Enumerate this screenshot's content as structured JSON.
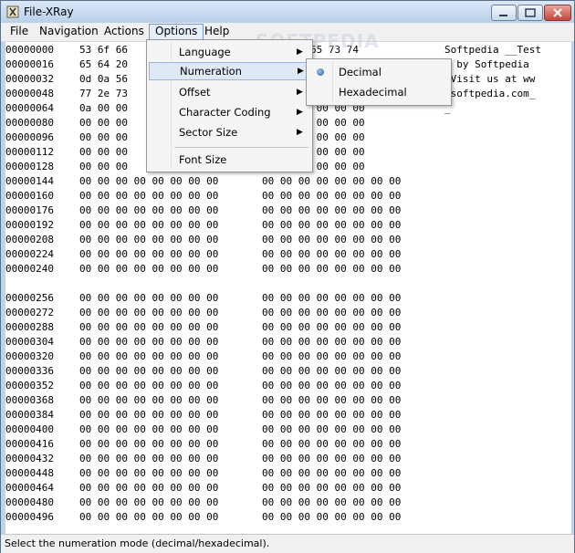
{
  "window": {
    "title": "File-XRay"
  },
  "menubar": {
    "items": [
      {
        "label": "File"
      },
      {
        "label": "Navigation"
      },
      {
        "label": "Actions"
      },
      {
        "label": "Options"
      },
      {
        "label": "Help"
      }
    ]
  },
  "options_menu": {
    "items": [
      {
        "label": "Language",
        "has_submenu": true
      },
      {
        "label": "Numeration",
        "has_submenu": true
      },
      {
        "label": "Offset",
        "has_submenu": true
      },
      {
        "label": "Character Coding",
        "has_submenu": true
      },
      {
        "label": "Sector Size",
        "has_submenu": true
      },
      {
        "label": "Font Size",
        "has_submenu": false
      }
    ]
  },
  "numeration_submenu": {
    "items": [
      {
        "label": "Decimal",
        "selected": true
      },
      {
        "label": "Hexadecimal",
        "selected": false
      }
    ]
  },
  "hex_rows": [
    {
      "offset": "00000000",
      "bytes1": "53 6f 66",
      "bytes2": "d 0a 54 65 73 74",
      "ascii": "Softpedia __Test"
    },
    {
      "offset": "00000016",
      "bytes1": "65 64 20",
      "bytes2": "",
      "ascii": "d by Softpedia"
    },
    {
      "offset": "00000032",
      "bytes1": "0d 0a 56",
      "bytes2": "",
      "ascii": "_Visit us at ww"
    },
    {
      "offset": "00000048",
      "bytes1": "77 2e 73",
      "bytes2": "",
      "ascii": ".softpedia.com_"
    },
    {
      "offset": "00000064",
      "bytes1": "0a 00 00",
      "bytes2": "00 00 00 00 00 00",
      "ascii": "_"
    },
    {
      "offset": "00000080",
      "bytes1": "00 00 00",
      "bytes2": "00 00 00 00 00 00",
      "ascii": ""
    },
    {
      "offset": "00000096",
      "bytes1": "00 00 00",
      "bytes2": "00 00 00 00 00 00",
      "ascii": ""
    },
    {
      "offset": "00000112",
      "bytes1": "00 00 00",
      "bytes2": "00 00 00 00 00 00",
      "ascii": ""
    },
    {
      "offset": "00000128",
      "bytes1": "00 00 00",
      "bytes2": "00 00 00 00 00 00",
      "ascii": ""
    },
    {
      "offset": "00000144",
      "bytes1": "00 00 00 00 00 00 00 00",
      "bytes2": "00 00 00 00 00 00 00 00",
      "ascii": ""
    },
    {
      "offset": "00000160",
      "bytes1": "00 00 00 00 00 00 00 00",
      "bytes2": "00 00 00 00 00 00 00 00",
      "ascii": ""
    },
    {
      "offset": "00000176",
      "bytes1": "00 00 00 00 00 00 00 00",
      "bytes2": "00 00 00 00 00 00 00 00",
      "ascii": ""
    },
    {
      "offset": "00000192",
      "bytes1": "00 00 00 00 00 00 00 00",
      "bytes2": "00 00 00 00 00 00 00 00",
      "ascii": ""
    },
    {
      "offset": "00000208",
      "bytes1": "00 00 00 00 00 00 00 00",
      "bytes2": "00 00 00 00 00 00 00 00",
      "ascii": ""
    },
    {
      "offset": "00000224",
      "bytes1": "00 00 00 00 00 00 00 00",
      "bytes2": "00 00 00 00 00 00 00 00",
      "ascii": ""
    },
    {
      "offset": "00000240",
      "bytes1": "00 00 00 00 00 00 00 00",
      "bytes2": "00 00 00 00 00 00 00 00",
      "ascii": ""
    },
    {
      "offset": "00000256",
      "bytes1": "00 00 00 00 00 00 00 00",
      "bytes2": "00 00 00 00 00 00 00 00",
      "ascii": ""
    },
    {
      "offset": "00000272",
      "bytes1": "00 00 00 00 00 00 00 00",
      "bytes2": "00 00 00 00 00 00 00 00",
      "ascii": ""
    },
    {
      "offset": "00000288",
      "bytes1": "00 00 00 00 00 00 00 00",
      "bytes2": "00 00 00 00 00 00 00 00",
      "ascii": ""
    },
    {
      "offset": "00000304",
      "bytes1": "00 00 00 00 00 00 00 00",
      "bytes2": "00 00 00 00 00 00 00 00",
      "ascii": ""
    },
    {
      "offset": "00000320",
      "bytes1": "00 00 00 00 00 00 00 00",
      "bytes2": "00 00 00 00 00 00 00 00",
      "ascii": ""
    },
    {
      "offset": "00000336",
      "bytes1": "00 00 00 00 00 00 00 00",
      "bytes2": "00 00 00 00 00 00 00 00",
      "ascii": ""
    },
    {
      "offset": "00000352",
      "bytes1": "00 00 00 00 00 00 00 00",
      "bytes2": "00 00 00 00 00 00 00 00",
      "ascii": ""
    },
    {
      "offset": "00000368",
      "bytes1": "00 00 00 00 00 00 00 00",
      "bytes2": "00 00 00 00 00 00 00 00",
      "ascii": ""
    },
    {
      "offset": "00000384",
      "bytes1": "00 00 00 00 00 00 00 00",
      "bytes2": "00 00 00 00 00 00 00 00",
      "ascii": ""
    },
    {
      "offset": "00000400",
      "bytes1": "00 00 00 00 00 00 00 00",
      "bytes2": "00 00 00 00 00 00 00 00",
      "ascii": ""
    },
    {
      "offset": "00000416",
      "bytes1": "00 00 00 00 00 00 00 00",
      "bytes2": "00 00 00 00 00 00 00 00",
      "ascii": ""
    },
    {
      "offset": "00000432",
      "bytes1": "00 00 00 00 00 00 00 00",
      "bytes2": "00 00 00 00 00 00 00 00",
      "ascii": ""
    },
    {
      "offset": "00000448",
      "bytes1": "00 00 00 00 00 00 00 00",
      "bytes2": "00 00 00 00 00 00 00 00",
      "ascii": ""
    },
    {
      "offset": "00000464",
      "bytes1": "00 00 00 00 00 00 00 00",
      "bytes2": "00 00 00 00 00 00 00 00",
      "ascii": ""
    },
    {
      "offset": "00000480",
      "bytes1": "00 00 00 00 00 00 00 00",
      "bytes2": "00 00 00 00 00 00 00 00",
      "ascii": ""
    },
    {
      "offset": "00000496",
      "bytes1": "00 00 00 00 00 00 00 00",
      "bytes2": "00 00 00 00 00 00 00 00",
      "ascii": ""
    }
  ],
  "statusbar": {
    "text": "Select the numeration mode (decimal/hexadecimal)."
  },
  "watermark": {
    "text": "SOFTPEDIA"
  }
}
